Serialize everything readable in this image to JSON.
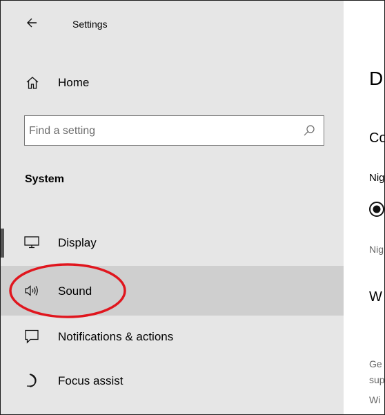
{
  "titlebar": {
    "title": "Settings",
    "back_icon": "back-arrow-icon"
  },
  "home": {
    "label": "Home",
    "icon": "home-icon"
  },
  "search": {
    "placeholder": "Find a setting",
    "value": "",
    "icon": "search-icon"
  },
  "section": {
    "heading": "System"
  },
  "nav": {
    "items": [
      {
        "label": "Display",
        "icon": "monitor-icon",
        "selected": true
      },
      {
        "label": "Sound",
        "icon": "speaker-icon",
        "hovered": true,
        "annotated": true
      },
      {
        "label": "Notifications & actions",
        "icon": "notification-icon"
      },
      {
        "label": "Focus assist",
        "icon": "moon-icon"
      }
    ]
  },
  "main": {
    "title": "D",
    "subheading": "Co",
    "label": "Nig",
    "note": "Nig",
    "subheading2": "W",
    "text1": "Ge",
    "text2": "sup",
    "text3": "Wi"
  },
  "colors": {
    "sidebar_bg": "#e6e6e6",
    "hover_bg": "#cfcfcf",
    "annotation": "#e0161e",
    "selected_indicator": "#555555"
  }
}
